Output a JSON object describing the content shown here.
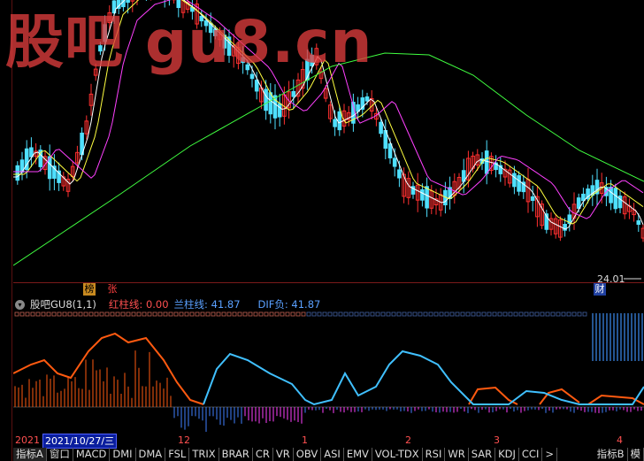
{
  "watermark": "股吧 gu8.cn",
  "price_label": "24.01",
  "badges": {
    "a": "榜",
    "b": "张",
    "c": "财"
  },
  "indicator": {
    "circle_glyph": "▾",
    "title": "股吧GU8(1,1)",
    "red_label": "红柱线: 0.00",
    "blue_label": "兰柱线: 41.87",
    "dif_label": "DIF负: 41.87"
  },
  "timeaxis": {
    "year": "2021",
    "selected_date": "2021/10/27/三",
    "ticks": [
      "12",
      "1",
      "2",
      "3",
      "4"
    ]
  },
  "tabs": [
    "指标A",
    "窗口",
    "MACD",
    "DMI",
    "DMA",
    "FSL",
    "TRIX",
    "BRAR",
    "CR",
    "VR",
    "OBV",
    "ASI",
    "EMV",
    "VOL-TDX",
    "RSI",
    "WR",
    "SAR",
    "KDJ",
    "CCI",
    ">"
  ],
  "tabs_right": [
    "指标B",
    "模"
  ],
  "colors": {
    "up": "#ff3030",
    "down": "#4fe0ff",
    "ma_white": "#ffffff",
    "ma_yellow": "#ffff40",
    "ma_magenta": "#ff40ff",
    "ma_green": "#40ff40",
    "osc_red": "#ff5a10",
    "osc_blue": "#40c0ff"
  }
}
